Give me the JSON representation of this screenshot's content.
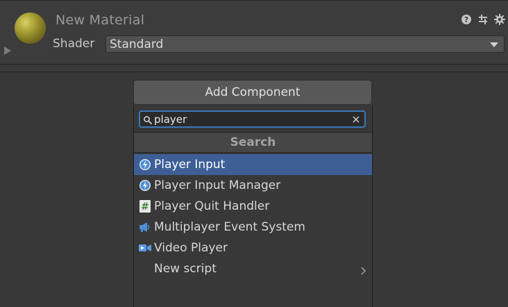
{
  "material": {
    "title": "New Material",
    "shader_label": "Shader",
    "shader_value": "Standard",
    "icons": [
      "help-icon",
      "preset-sliders-icon",
      "gear-icon"
    ]
  },
  "add_component": {
    "button_label": "Add Component",
    "search": {
      "value": "player",
      "placeholder": ""
    },
    "section_title": "Search",
    "results": [
      {
        "label": "Player Input",
        "icon": "input-lightning-icon",
        "selected": true
      },
      {
        "label": "Player Input Manager",
        "icon": "input-lightning-icon",
        "selected": false
      },
      {
        "label": "Player Quit Handler",
        "icon": "script-hash-icon",
        "selected": false
      },
      {
        "label": "Multiplayer Event System",
        "icon": "event-megaphone-icon",
        "selected": false
      },
      {
        "label": "Video Player",
        "icon": "video-camera-icon",
        "selected": false
      },
      {
        "label": "New script",
        "icon": "",
        "selected": false,
        "has_submenu": true
      }
    ]
  },
  "colors": {
    "accent_focus": "#3a79bb",
    "selection": "#3e5f96",
    "sphere": "#b3aa3c"
  }
}
